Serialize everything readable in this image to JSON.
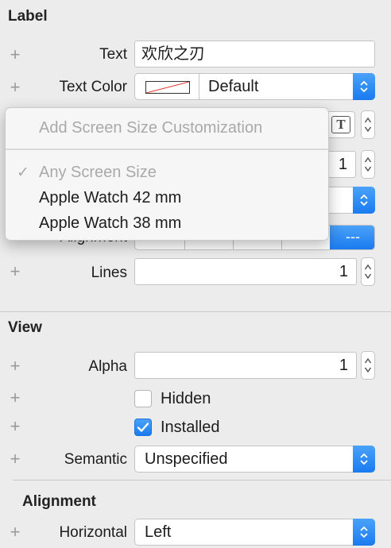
{
  "label_section": {
    "title": "Label",
    "text_label": "Text",
    "text_value": "欢欣之刃",
    "text_color_label": "Text Color",
    "text_color_value": "Default",
    "font_button_glyph": "T",
    "min_font_value": "1",
    "alignment_label": "Alignment",
    "alignment_selected": "---",
    "lines_label": "Lines",
    "lines_value": "1"
  },
  "menu": {
    "header": "Add Screen Size Customization",
    "checkmark": "✓",
    "items": [
      "Any Screen Size",
      "Apple Watch 42 mm",
      "Apple Watch 38 mm"
    ]
  },
  "view_section": {
    "title": "View",
    "alpha_label": "Alpha",
    "alpha_value": "1",
    "hidden_label": "Hidden",
    "hidden_checked": false,
    "installed_label": "Installed",
    "installed_checked": true,
    "semantic_label": "Semantic",
    "semantic_value": "Unspecified"
  },
  "alignment_section": {
    "title": "Alignment",
    "horizontal_label": "Horizontal",
    "horizontal_value": "Left"
  },
  "colors": {
    "accent": "#1a7bf0",
    "panel_bg": "#ececec",
    "disabled_text": "#a9a9a9"
  },
  "icons": {
    "plus": "plus-icon",
    "stepper": "stepper-arrows-icon",
    "popup": "popup-arrows-icon",
    "checkmark": "checkmark-icon",
    "font": "font-T-icon"
  }
}
